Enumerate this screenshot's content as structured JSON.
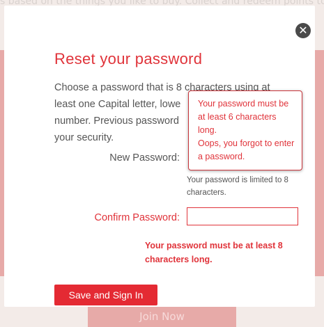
{
  "background": {
    "top_text": "s based on the things you like to buy. Collect and redeem points towar",
    "join_label": "Join Now"
  },
  "modal": {
    "title": "Reset your password",
    "description": "Choose a password that is 8 characters using at least one Capital letter, lowe number. Previous password your security.",
    "description_lines": [
      "Choose a password that is 8 characters using at",
      "least one Capital letter, lowe",
      "number. Previous password",
      "your security."
    ],
    "close_icon": "close-icon",
    "new_password": {
      "label": "New Password:",
      "hint": "Your password is limited to 8 characters.",
      "tooltip_line1": "Your password must be at least 6 characters long.",
      "tooltip_line2": "Oops, you forgot to enter a password."
    },
    "confirm_password": {
      "label": "Confirm Password:",
      "value": "",
      "error": "Your password must be at least 8 characters long."
    },
    "save_label": "Save and Sign In"
  },
  "colors": {
    "accent": "#e42a33",
    "error_text": "#e0333a",
    "overlay_band": "#e7aaa8"
  }
}
